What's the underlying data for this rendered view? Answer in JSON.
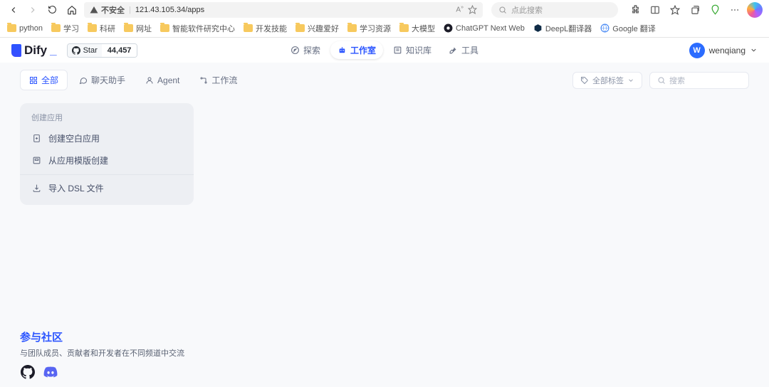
{
  "browser": {
    "insecure_label": "不安全",
    "url": "121.43.105.34/apps",
    "search_placeholder": "点此搜索"
  },
  "bookmarks": [
    {
      "type": "folder",
      "label": "python"
    },
    {
      "type": "folder",
      "label": "学习"
    },
    {
      "type": "folder",
      "label": "科研"
    },
    {
      "type": "folder",
      "label": "网址"
    },
    {
      "type": "folder",
      "label": "智能软件研究中心"
    },
    {
      "type": "folder",
      "label": "开发技能"
    },
    {
      "type": "folder",
      "label": "兴趣爱好"
    },
    {
      "type": "folder",
      "label": "学习资源"
    },
    {
      "type": "folder",
      "label": "大模型"
    },
    {
      "type": "chatgpt",
      "label": "ChatGPT Next Web"
    },
    {
      "type": "deepl",
      "label": "DeepL翻译器"
    },
    {
      "type": "google",
      "label": "Google 翻译"
    }
  ],
  "header": {
    "logo_text": "Dify",
    "gh_star": "Star",
    "gh_count": "44,457",
    "nav": [
      {
        "label": "探索",
        "icon": "compass"
      },
      {
        "label": "工作室",
        "icon": "robot",
        "active": true
      },
      {
        "label": "知识库",
        "icon": "book"
      },
      {
        "label": "工具",
        "icon": "wrench"
      }
    ],
    "user_initial": "W",
    "user_name": "wenqiang"
  },
  "tabs": {
    "items": [
      {
        "label": "全部",
        "icon": "grid",
        "active": true
      },
      {
        "label": "聊天助手",
        "icon": "chat"
      },
      {
        "label": "Agent",
        "icon": "agent"
      },
      {
        "label": "工作流",
        "icon": "flow"
      }
    ],
    "tags_label": "全部标签",
    "search_placeholder": "搜索"
  },
  "create_card": {
    "title": "创建应用",
    "items": [
      {
        "label": "创建空白应用",
        "icon": "new-file"
      },
      {
        "label": "从应用模版创建",
        "icon": "template"
      },
      {
        "label": "导入 DSL 文件",
        "icon": "import"
      }
    ]
  },
  "community": {
    "title": "参与社区",
    "subtitle": "与团队成员、贡献者和开发者在不同频道中交流"
  }
}
